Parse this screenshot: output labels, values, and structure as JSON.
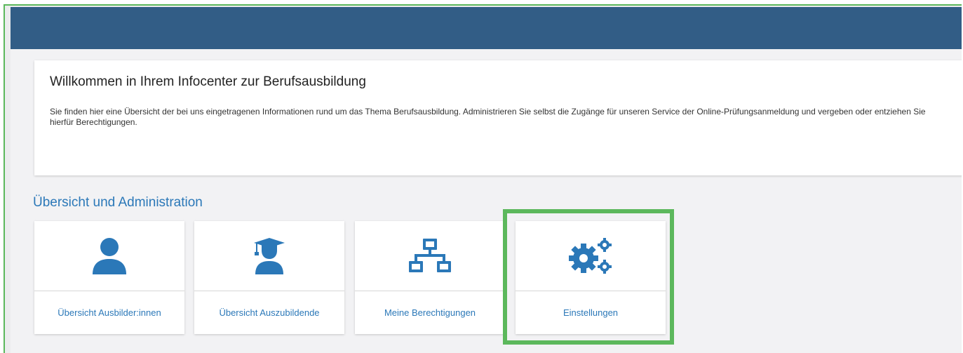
{
  "colors": {
    "header": "#325d86",
    "accent": "#2b78b8",
    "highlight": "#5cb85c",
    "background": "#f2f2f4"
  },
  "welcome": {
    "title": "Willkommen in Ihrem Infocenter zur Berufsausbildung",
    "text": "Sie finden hier eine Übersicht der bei uns eingetragenen Informationen rund um das Thema Berufsausbildung. Administrieren Sie selbst die Zugänge für unseren Service der Online-Prüfungsanmeldung und vergeben oder entziehen Sie hierfür Berechtigungen."
  },
  "section": {
    "title": "Übersicht und Administration"
  },
  "tiles": [
    {
      "label": "Übersicht Ausbilder:innen",
      "icon": "user-icon"
    },
    {
      "label": "Übersicht Auszubildende",
      "icon": "graduate-icon"
    },
    {
      "label": "Meine Berechtigungen",
      "icon": "network-icon"
    },
    {
      "label": "Einstellungen",
      "icon": "gears-icon"
    }
  ]
}
